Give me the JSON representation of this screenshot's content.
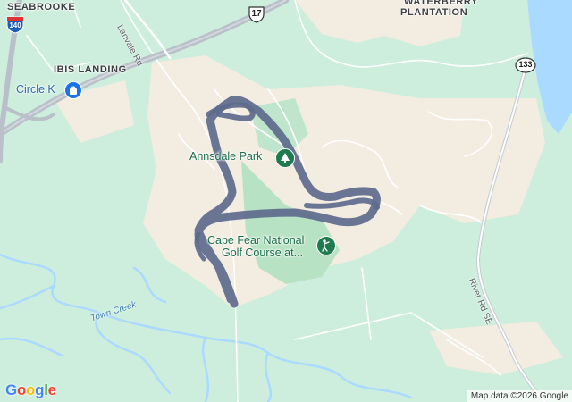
{
  "map": {
    "colors": {
      "land": "#cdeedc",
      "park": "#bfe6cc",
      "developed": "#f2ece1",
      "water": "#aadaff",
      "road": "#ffffff",
      "highway": "#b9c0c9",
      "route": "#5d6a8c",
      "park_marker": "#1f7a4d",
      "shop_marker": "#1a73e8"
    },
    "area_labels": {
      "seabrooke": "SEABROOKE",
      "ibis_landing": "IBIS LANDING",
      "waterberry_1": "WATERBERRY",
      "waterberry_2": "PLANTATION"
    },
    "pois": {
      "circle_k": {
        "name": "Circle K",
        "icon": "shopping-bag-icon"
      },
      "annsdale_park": {
        "name": "Annsdale Park",
        "icon": "tree-icon"
      },
      "golf_course_1": "Cape Fear National",
      "golf_course_2": "Golf Course at...",
      "golf_icon": "golfer-icon"
    },
    "road_labels": {
      "lanvale": "Lanvale Rd",
      "river_rd": "River Rd SE",
      "town_creek": "Town Creek"
    },
    "shields": {
      "i140": "140",
      "us17": "17",
      "nc133": "133"
    },
    "branding": {
      "logo": "Google",
      "logo_colors": [
        "#4285F4",
        "#EA4335",
        "#FBBC05",
        "#4285F4",
        "#34A853",
        "#EA4335"
      ]
    },
    "attribution": "Map data ©2026 Google"
  }
}
